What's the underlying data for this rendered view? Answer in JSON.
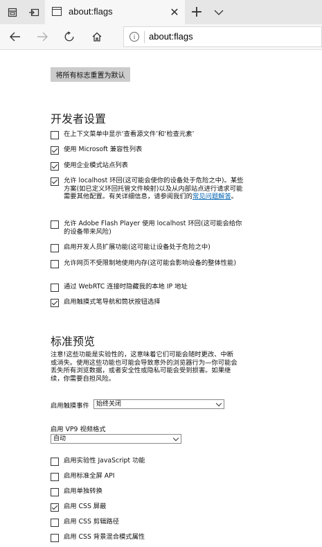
{
  "tab": {
    "title": "about:flags",
    "close": "✕"
  },
  "tabstrip": {
    "new_tab": "+",
    "more": "⌄"
  },
  "address": {
    "url": "about:flags",
    "info": "i"
  },
  "reset_button": "将所有标志重置为默认",
  "dev_section": {
    "heading": "开发者设置",
    "items": [
      {
        "label": "在上下文菜单中显示‘查看源文件’和‘检查元素’",
        "checked": false
      },
      {
        "label": "使用 Microsoft 兼容性列表",
        "checked": true
      },
      {
        "label": "使用企业模式站点列表",
        "checked": true
      },
      {
        "label": "允许 localhost 环回(这可能会使你的设备处于危险之中)。某些方案(如已定义环回托管文件映射)以及从内部站点进行请求可能需要其他配置。有关详细信息，请参阅我们的",
        "link": "常见问题解答",
        "after": "。",
        "checked": true
      },
      {
        "label": "允许 Adobe Flash Player 使用 localhost 环回(这可能会给你的设备带来风险)",
        "checked": false
      },
      {
        "label": "启用开发人员扩展功能(这可能让设备处于危险之中)",
        "checked": false
      },
      {
        "label": "允许网页不受限制地使用内存(这可能会影响设备的整体性能)",
        "checked": false
      },
      {
        "label": "通过 WebRTC 连接时隐藏我的本地 IP 地址",
        "checked": false
      },
      {
        "label": "启用触摸式笔导航和筒状按钮选择",
        "checked": true
      }
    ]
  },
  "std_section": {
    "heading": "标准预览",
    "note": "注意!这些功能是实验性的，这意味着它们可能会随时更改、中断或消失。使用这些功能也可能会导致意外的浏览器行为—你可能会丢失所有浏览数据，或者安全性或隐私可能会受到损害。如果继续，你需要自担风险。",
    "touch_label": "启用触摸事件",
    "touch_value": "始终关闭",
    "vp9_label": "启用 VP9 视频格式",
    "vp9_value": "自动",
    "items": [
      {
        "label": "启用实验性 JavaScript 功能",
        "checked": false
      },
      {
        "label": "启用标准全屏 API",
        "checked": false
      },
      {
        "label": "启用单独转换",
        "checked": false
      },
      {
        "label": "启用 CSS 屏蔽",
        "checked": true
      },
      {
        "label": "启用 CSS 剪辑路径",
        "checked": false
      },
      {
        "label": "启用 CSS 背景混合模式属性",
        "checked": false
      }
    ]
  }
}
